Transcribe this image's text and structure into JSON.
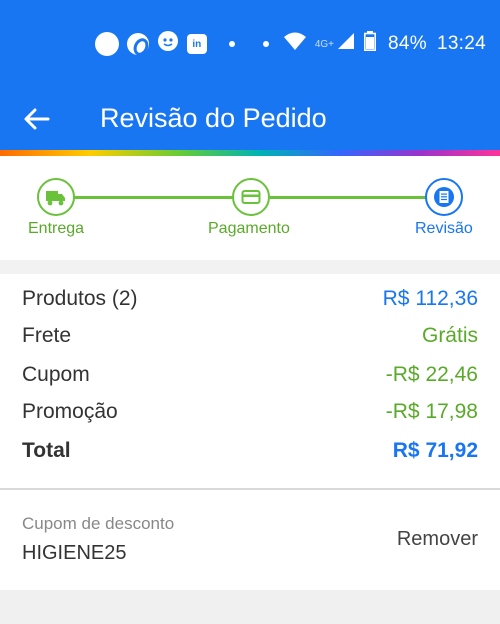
{
  "status_bar": {
    "network": "4G+",
    "battery": "84%",
    "time": "13:24"
  },
  "app_bar": {
    "title": "Revisão do Pedido"
  },
  "stepper": {
    "steps": [
      {
        "label": "Entrega",
        "icon": "truck-icon",
        "state": "done"
      },
      {
        "label": "Pagamento",
        "icon": "credit-card-icon",
        "state": "done"
      },
      {
        "label": "Revisão",
        "icon": "document-icon",
        "state": "active"
      }
    ],
    "colors": {
      "done": "#6ac23a",
      "active": "#1976f2"
    }
  },
  "summary": {
    "rows": [
      {
        "label": "Produtos (2)",
        "value": "R$ 112,36"
      },
      {
        "label": "Frete",
        "value": "Grátis"
      },
      {
        "label": "Cupom",
        "value": "-R$ 22,46"
      },
      {
        "label": "Promoção",
        "value": "-R$ 17,98"
      },
      {
        "label": "Total",
        "value": "R$ 71,92"
      }
    ]
  },
  "coupon": {
    "label": "Cupom de desconto",
    "code": "HIGIENE25",
    "remove_label": "Remover"
  },
  "colors": {
    "primary": "#1976f2",
    "success": "#5aaa2a"
  }
}
